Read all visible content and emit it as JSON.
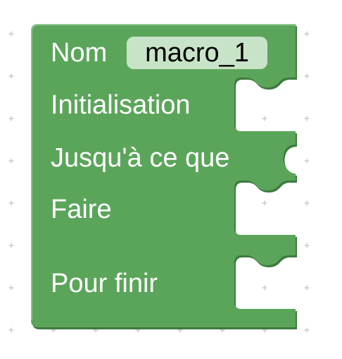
{
  "block": {
    "name_label": "Nom",
    "name_value": "macro_1",
    "init_label": "Initialisation",
    "until_label": "Jusqu'à ce que",
    "do_label": "Faire",
    "finally_label": "Pour finir"
  },
  "colors": {
    "block_fill": "#5ba55b",
    "block_shadow": "#3f7a3f",
    "block_highlight": "#8cc58c",
    "field_fill": "#c8e4c8",
    "grid_plus": "#cccccc"
  }
}
